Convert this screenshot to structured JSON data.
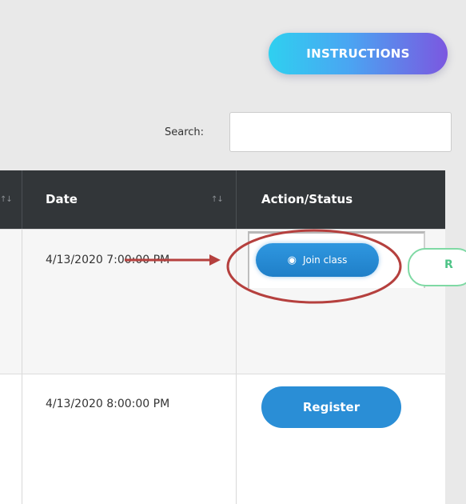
{
  "toolbar": {
    "instructions_label": "INSTRUCTIONS"
  },
  "search": {
    "label": "Search:",
    "value": "",
    "placeholder": ""
  },
  "table": {
    "columns": [
      {
        "label": "",
        "sort_icon": "↑↓"
      },
      {
        "label": "Date",
        "sort_icon": "↑↓"
      },
      {
        "label": "Action/Status"
      }
    ],
    "rows": [
      {
        "date": "4/13/2020 7:00:00 PM",
        "action_label": "Join class",
        "action_icon": "user-icon",
        "secondary_button_partial": "R"
      },
      {
        "date": "4/13/2020 8:00:00 PM",
        "action_label": "Register"
      }
    ]
  },
  "colors": {
    "instructions_gradient_start": "#2fd0f0",
    "instructions_gradient_end": "#7b57e0",
    "header_bg": "#323639",
    "primary_button": "#2a8ed6",
    "annotation_red": "#b5403e",
    "partial_button_border": "#7fd9a4"
  }
}
